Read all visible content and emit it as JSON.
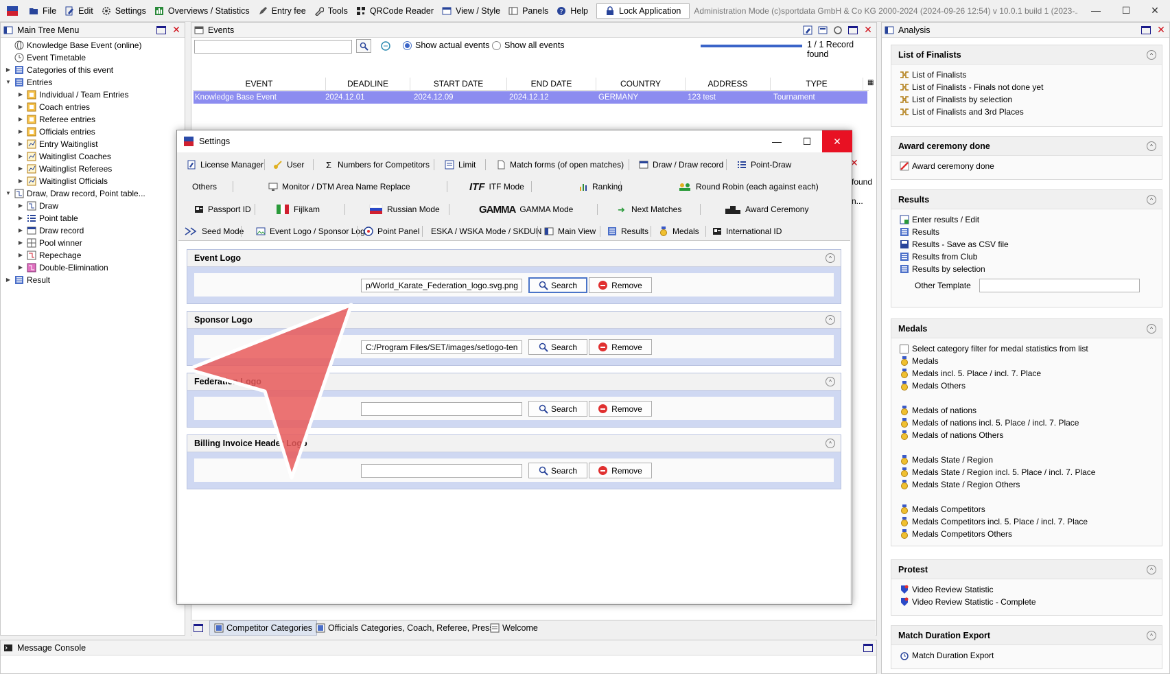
{
  "menubar": {
    "items": [
      "File",
      "Edit",
      "Settings",
      "Overviews / Statistics",
      "Entry fee",
      "Tools",
      "QRCode Reader",
      "View / Style",
      "Panels",
      "Help"
    ],
    "lock_label": "Lock Application",
    "title": "Administration Mode (c)sportdata GmbH & Co KG 2000-2024 (2024-09-26 12:54)  v 10.0.1 build 1 (2023-..."
  },
  "tree": {
    "title": "Main Tree Menu",
    "items": [
      "Knowledge Base Event (online)",
      "Event Timetable",
      "Categories of this event",
      "Entries",
      "Individual / Team Entries",
      "Coach entries",
      "Referee entries",
      "Officials entries",
      "Entry Waitinglist",
      "Waitinglist Coaches",
      "Waitinglist Referees",
      "Waitinglist Officials",
      "Draw, Draw record, Point table...",
      "Draw",
      "Point table",
      "Draw record",
      "Pool winner",
      "Repechage",
      "Double-Elimination",
      "Result"
    ]
  },
  "events": {
    "title": "Events",
    "radio_actual": "Show actual events",
    "radio_all": "Show all events",
    "record_count": "1 / 1 Record found",
    "columns": [
      "EVENT",
      "DEADLINE",
      "START DATE",
      "END DATE",
      "COUNTRY",
      "ADDRESS",
      "TYPE"
    ],
    "row": [
      "Knowledge Base Event",
      "2024.12.01",
      "2024.12.09",
      "2024.12.12",
      "GERMANY",
      "123 test",
      "Tournament"
    ],
    "behind_found": "found",
    "behind_n": "n..."
  },
  "bottom_tabs": [
    "Competitor Categories",
    "Officials Categories, Coach, Referee, Press",
    "Welcome"
  ],
  "console": {
    "title": "Message Console"
  },
  "analysis": {
    "title": "Analysis",
    "finalists": {
      "title": "List of Finalists",
      "items": [
        "List of Finalists",
        "List of Finalists - Finals not done yet",
        "List of Finalists by selection",
        "List of Finalists and 3rd Places"
      ]
    },
    "award": {
      "title": "Award ceremony done",
      "items": [
        "Award ceremony done"
      ]
    },
    "results": {
      "title": "Results",
      "items": [
        "Enter results / Edit",
        "Results",
        "Results - Save as CSV file",
        "Results from Club",
        "Results by selection"
      ],
      "other_template": "Other Template"
    },
    "medals": {
      "title": "Medals",
      "filter_label": "Select category filter for medal statistics from list",
      "group1": [
        "Medals",
        "Medals incl. 5. Place / incl. 7. Place",
        "Medals Others"
      ],
      "group2": [
        "Medals of nations",
        "Medals of nations incl. 5. Place / incl. 7. Place",
        "Medals of nations Others"
      ],
      "group3": [
        "Medals State / Region",
        "Medals State / Region incl. 5. Place / incl. 7. Place",
        "Medals State / Region Others"
      ],
      "group4": [
        "Medals Competitors",
        "Medals Competitors incl. 5. Place / incl. 7. Place",
        "Medals Competitors Others"
      ]
    },
    "protest": {
      "title": "Protest",
      "items": [
        "Video Review Statistic",
        "Video Review Statistic - Complete"
      ]
    },
    "duration": {
      "title": "Match Duration Export",
      "items": [
        "Match Duration Export"
      ]
    }
  },
  "settings": {
    "title": "Settings",
    "row1": [
      "License Manager",
      "User",
      "Numbers for Competitors",
      "Limit",
      "Match forms (of open matches)",
      "Draw / Draw record",
      "Point-Draw"
    ],
    "row2": [
      "Others",
      "Monitor / DTM Area Name Replace",
      "ITF Mode",
      "Ranking",
      "Round Robin (each against each)"
    ],
    "row3": [
      "Passport ID",
      "Fijlkam",
      "Russian Mode",
      "GAMMA Mode",
      "Next Matches",
      "Award Ceremony"
    ],
    "row4": [
      "Seed Mode",
      "Event Logo / Sponsor Logo",
      "Point Panel",
      "ESKA / WSKA Mode / SKDUN",
      "Main View",
      "Results",
      "Medals",
      "International ID"
    ],
    "logo_text_itf": "ITF",
    "logo_text_gamma": "GAMMA",
    "sections": [
      {
        "title": "Event Logo",
        "value": "p/World_Karate_Federation_logo.svg.png"
      },
      {
        "title": "Sponsor Logo",
        "value": "C:/Program Files/SET/images/setlogo-ten"
      },
      {
        "title": "Federation Logo",
        "value": ""
      },
      {
        "title": "Billing Invoice Header Logo",
        "value": ""
      }
    ],
    "search_label": "Search",
    "remove_label": "Remove"
  },
  "colors": {
    "selection_row": "#8c8cf0",
    "section_blue": "#cfd8f2",
    "close_red": "#e81123",
    "arrow_red": "#e85a5a"
  }
}
